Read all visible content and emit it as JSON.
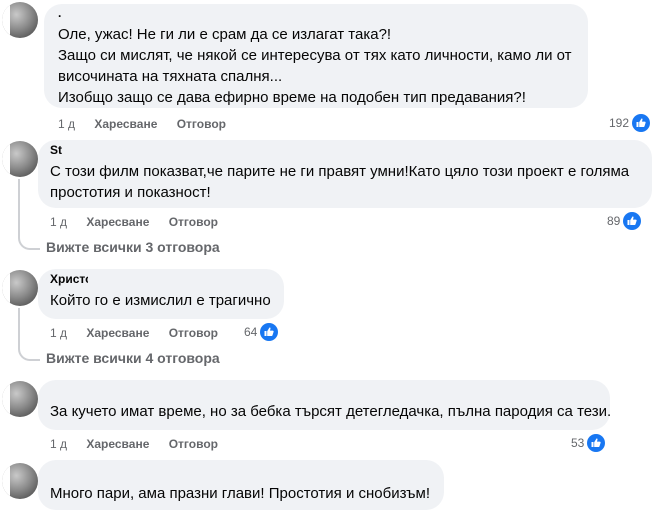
{
  "comments": [
    {
      "author": ".",
      "text_lines": [
        "Оле, ужас! Не ги ли е срам да се излагат така?!",
        "Защо си мислят, че някой се интересува от тях като личности, камо ли от",
        "височината на тяхната спалня...",
        "Изобщо защо се дава ефирно време на подобен тип предавания?!"
      ],
      "time": "1 д",
      "like_label": "Харесване",
      "reply_label": "Отговор",
      "reactions": "192"
    },
    {
      "author": "St",
      "text_lines": [
        "С този филм показват,че парите не ги правят умни!Като цяло този проект е голяма",
        "простотия и показност!"
      ],
      "time": "1 д",
      "like_label": "Харесване",
      "reply_label": "Отговор",
      "reactions": "89",
      "view_replies": "Вижте всички 3 отговора"
    },
    {
      "author": "Христо",
      "text_lines": [
        "Който го е измислил е трагично"
      ],
      "time": "1 д",
      "like_label": "Харесване",
      "reply_label": "Отговор",
      "reactions": "64",
      "view_replies": "Вижте всички 4 отговора"
    },
    {
      "author": "",
      "text_lines": [
        "За кучето имат време, но за бебка търсят детегледачка, пълна пародия са тези."
      ],
      "time": "1 д",
      "like_label": "Харесване",
      "reply_label": "Отговор",
      "reactions": "53"
    },
    {
      "author": "",
      "text_lines": [
        "Много пари, ама празни глави! Простотия и снобизъм!"
      ]
    }
  ],
  "colors": {
    "bubble": "#f0f2f5",
    "meta_text": "#65676b",
    "like_blue": "#1877f2",
    "thread_line": "#ced0d4"
  },
  "icons": {
    "reaction": "like-thumbs-up-icon"
  }
}
